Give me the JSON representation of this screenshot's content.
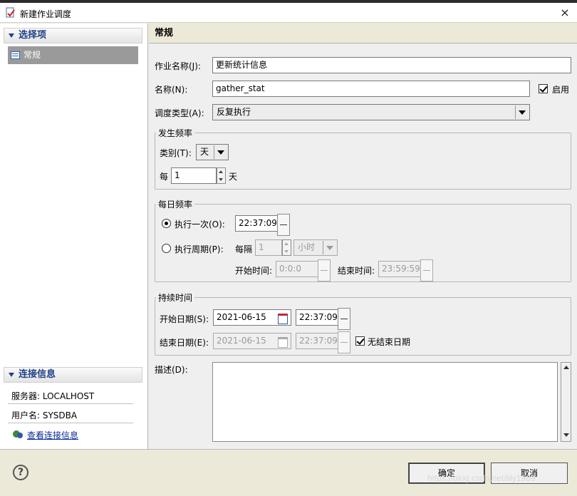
{
  "window": {
    "title": "新建作业调度",
    "close_glyph": "×"
  },
  "left_panel": {
    "select_header": "选择项",
    "items": [
      {
        "label": "常规",
        "selected": true
      }
    ],
    "connection_header": "连接信息",
    "server": "服务器: LOCALHOST",
    "user": "用户名: SYSDBA",
    "view_link": "查看连接信息"
  },
  "main": {
    "section_title": "常规",
    "job_name_label": "作业名称(J):",
    "job_name_value": "更新统计信息",
    "name_label": "名称(N):",
    "name_value": "gather_stat",
    "enable_label": "启用",
    "enable_checked": true,
    "schedule_type_label": "调度类型(A):",
    "schedule_type_value": "反复执行",
    "frequency": {
      "legend": "发生频率",
      "category_label": "类别(T):",
      "category_value": "天",
      "every_label": "每",
      "every_value": "1",
      "every_unit": "天"
    },
    "daily": {
      "legend": "每日频率",
      "once_label": "执行一次(O):",
      "once_selected": true,
      "once_time": "22:37:09",
      "period_label": "执行周期(P):",
      "interval_label": "每隔",
      "interval_value": "1",
      "interval_unit": "小时",
      "start_time_label": "开始时间:",
      "start_time_value": "0:0:0",
      "end_time_label": "结束时间:",
      "end_time_value": "23:59:59"
    },
    "duration": {
      "legend": "持续时间",
      "start_date_label": "开始日期(S):",
      "start_date_value": "2021-06-15",
      "start_time_value": "22:37:09",
      "end_date_label": "结束日期(E):",
      "end_date_value": "2021-06-15",
      "end_time_value": "22:37:09",
      "no_end_label": "无结束日期",
      "no_end_checked": true
    },
    "description_label": "描述(D):"
  },
  "buttons": {
    "ok": "确定",
    "cancel": "取消",
    "help_glyph": "?"
  },
  "watermark": "https://blog.csdn.net/lily1989",
  "colors": {
    "accent": "#1f3f88",
    "selected_bg": "#9a9a9a",
    "link": "#0a2a9a"
  }
}
